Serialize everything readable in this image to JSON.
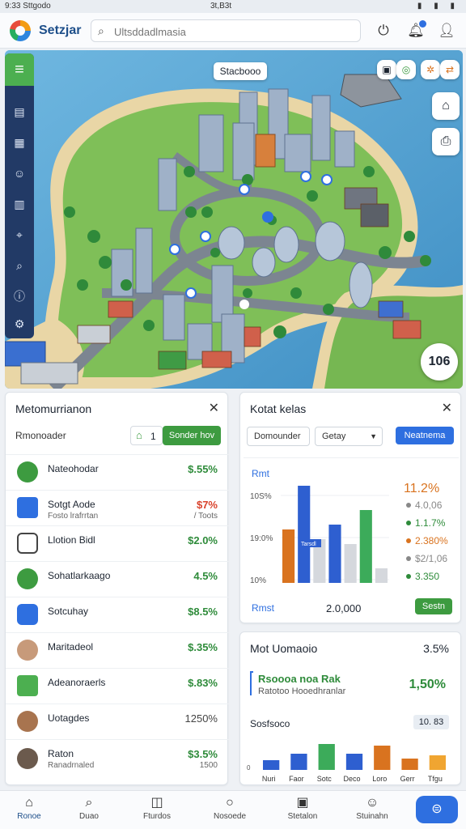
{
  "statusbar": {
    "left": "9:33 Sttgodo",
    "center": "3t,B3t",
    "right": "▮ ▮ ▮"
  },
  "topbar": {
    "title": "Setzjar",
    "search_placeholder": "Ultsddadlmasia",
    "accent": "#1e4f8a"
  },
  "map": {
    "label": "Stacbooo",
    "counter": "106",
    "rail_icons": [
      "doc-icon",
      "chart-icon",
      "user-icon",
      "building-icon",
      "pin-icon",
      "search-icon",
      "info-icon",
      "gear-icon"
    ]
  },
  "left_panel": {
    "title": "Metomurrianon",
    "filter_label": "Rmonoader",
    "filter_count": "1",
    "filter_button": "Sonder hov",
    "rows": [
      {
        "name": "Nateohodar",
        "sub": "",
        "value": "$.55%",
        "value_color": "#2e8b3a",
        "sub_value": ""
      },
      {
        "name": "Sotgt Aode",
        "sub": "Fosto lrafrrtan",
        "value": "$7%",
        "value_color": "#d9422b",
        "sub_value": "/ Toots"
      },
      {
        "name": "Llotion Bidl",
        "sub": "",
        "value": "$2.0%",
        "value_color": "#2e8b3a",
        "sub_value": ""
      },
      {
        "name": "Sohatlarkaago",
        "sub": "",
        "value": "4.5%",
        "value_color": "#2e8b3a",
        "sub_value": ""
      },
      {
        "name": "Sotcuhay",
        "sub": "",
        "value": "$8.5%",
        "value_color": "#2e8b3a",
        "sub_value": ""
      },
      {
        "name": "Maritadeol",
        "sub": "",
        "value": "$.35%",
        "value_color": "#2e8b3a",
        "sub_value": ""
      },
      {
        "name": "Adeanoraerls",
        "sub": "",
        "value": "$.83%",
        "value_color": "#2e8b3a",
        "sub_value": ""
      },
      {
        "name": "Uotagdes",
        "sub": "",
        "value": "1250%",
        "value_color": "#444444",
        "sub_value": ""
      },
      {
        "name": "Raton",
        "sub": "Ranadrnaled",
        "value": "$3.5%",
        "value_color": "#2e8b3a",
        "sub_value": "1500"
      }
    ]
  },
  "right_panel": {
    "title": "Kotat kelas",
    "input1": "Domounder",
    "select1": "Getay",
    "button": "Neatnema",
    "chart_title": "Rmt",
    "chart_footer_label": "Rmst",
    "chart_footer_value": "2.0,000",
    "chart_footer_button": "Sestn",
    "bar_tag": "Tarsdl"
  },
  "chart_data": [
    {
      "type": "bar",
      "title": "Rmt",
      "ytick_labels": [
        "10S%",
        "19:0%",
        "10%"
      ],
      "series": [
        {
          "color": "#d9731f",
          "values": [
            0.55,
            0,
            0,
            0,
            0
          ]
        },
        {
          "color": "#2e5fd0",
          "values": [
            1.0,
            0.62,
            0,
            0,
            0
          ]
        },
        {
          "color": "#d5d8dd",
          "values": [
            0,
            0.45,
            0,
            0,
            0
          ]
        },
        {
          "color": "#2e5fd0",
          "values": [
            0,
            0,
            0.6,
            0,
            0
          ]
        },
        {
          "color": "#d5d8dd",
          "values": [
            0,
            0,
            0.4,
            0,
            0
          ]
        },
        {
          "color": "#3cab5a",
          "values": [
            0,
            0,
            0,
            0.75,
            0
          ]
        },
        {
          "color": "#d5d8dd",
          "values": [
            0,
            0,
            0,
            0.15,
            0
          ]
        }
      ],
      "legend": [
        {
          "label": "11.2%",
          "color": "#d9731f",
          "big": true
        },
        {
          "label": "4.0,06",
          "color": "#888888"
        },
        {
          "label": "1.1.7%",
          "color": "#2e8b3a"
        },
        {
          "label": "2.380%",
          "color": "#d9731f"
        },
        {
          "label": "$2/1,06",
          "color": "#888888"
        },
        {
          "label": "3.350",
          "color": "#2e8b3a"
        }
      ]
    },
    {
      "type": "bar",
      "title": "Sosfsoco",
      "categories": [
        "Nuri",
        "Faor",
        "Sotc",
        "Deco",
        "Loro",
        "Gerr",
        "Tfgu"
      ],
      "values": [
        0.3,
        0.5,
        0.8,
        0.5,
        0.75,
        0.35,
        0.45
      ],
      "colors": [
        "#2e5fd0",
        "#2e5fd0",
        "#3cab5a",
        "#2e5fd0",
        "#d9731f",
        "#d9731f",
        "#f0a531"
      ],
      "ytick_labels": [
        "0"
      ],
      "badge": "10. 83"
    }
  ],
  "metric_panel": {
    "title": "Mot Uomaoio",
    "value": "3.5%",
    "headline": "Rsoooa noa Rak",
    "subline": "Ratotoo Hooedhranlar",
    "highlight": "1,50%",
    "highlight_color": "#2e8b3a"
  },
  "bottomnav": [
    {
      "label": "Ronoe",
      "icon": "home-icon",
      "active": true
    },
    {
      "label": "Duao",
      "icon": "search-icon",
      "active": false
    },
    {
      "label": "Fturdos",
      "icon": "chart-icon",
      "active": false
    },
    {
      "label": "Nosoede",
      "icon": "globe-icon",
      "active": false
    },
    {
      "label": "Stetalon",
      "icon": "calendar-icon",
      "active": false
    },
    {
      "label": "Stuinahn",
      "icon": "user-icon",
      "active": false
    }
  ]
}
